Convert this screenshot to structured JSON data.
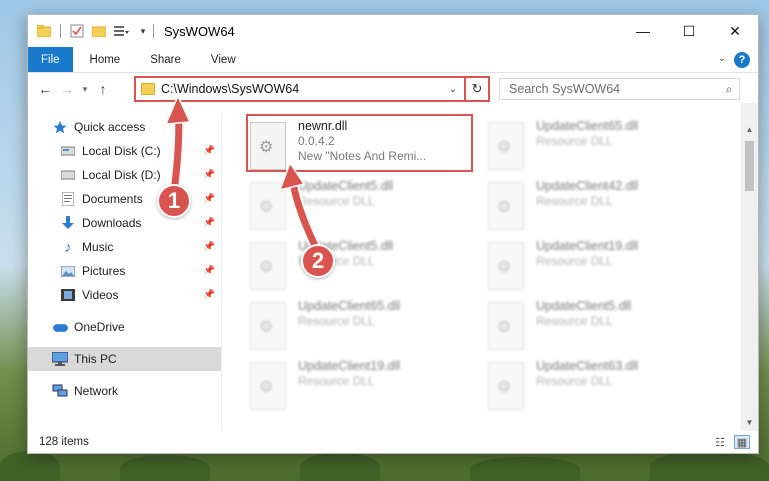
{
  "window": {
    "title": "SysWOW64",
    "controls": {
      "minimize": "—",
      "maximize": "☐",
      "close": "✕"
    }
  },
  "ribbon": {
    "tabs": [
      "File",
      "Home",
      "Share",
      "View"
    ],
    "help": "?"
  },
  "nav": {
    "address": "C:\\Windows\\SysWOW64",
    "search_placeholder": "Search SysWOW64"
  },
  "sidebar": {
    "items": [
      {
        "label": "Quick access",
        "icon": "star-icon"
      },
      {
        "label": "Local Disk (C:)",
        "icon": "drive-icon",
        "pinned": true
      },
      {
        "label": "Local Disk (D:)",
        "icon": "drive-icon",
        "pinned": true
      },
      {
        "label": "Documents",
        "icon": "documents-icon",
        "pinned": true
      },
      {
        "label": "Downloads",
        "icon": "download-icon",
        "pinned": true
      },
      {
        "label": "Music",
        "icon": "music-icon",
        "pinned": true
      },
      {
        "label": "Pictures",
        "icon": "pictures-icon",
        "pinned": true
      },
      {
        "label": "Videos",
        "icon": "videos-icon",
        "pinned": true
      },
      {
        "label": "OneDrive",
        "icon": "cloud-icon"
      },
      {
        "label": "This PC",
        "icon": "computer-icon",
        "selected": true
      },
      {
        "label": "Network",
        "icon": "network-icon"
      }
    ]
  },
  "files": [
    {
      "name": "newnr.dll",
      "line1": "0.0.4.2",
      "line2": "New \"Notes And Remi...",
      "highlighted": true
    },
    {
      "name": "UpdateClient65.dll",
      "line1": "Resource DLL"
    },
    {
      "name": "UpdateClient5.dll",
      "line1": "Resource DLL"
    },
    {
      "name": "UpdateClient42.dll",
      "line1": "Resource DLL"
    },
    {
      "name": "UpdateClient5.dll",
      "line1": "Resource DLL"
    },
    {
      "name": "UpdateClient19.dll",
      "line1": "Resource DLL"
    },
    {
      "name": "UpdateClient65.dll",
      "line1": "Resource DLL"
    },
    {
      "name": "UpdateClient5.dll",
      "line1": "Resource DLL"
    },
    {
      "name": "UpdateClient19.dll",
      "line1": "Resource DLL"
    },
    {
      "name": "UpdateClient63.dll",
      "line1": "Resource DLL"
    }
  ],
  "status": {
    "items": "128 items"
  },
  "annotations": {
    "step1": "1",
    "step2": "2",
    "color": "#d9534f"
  }
}
